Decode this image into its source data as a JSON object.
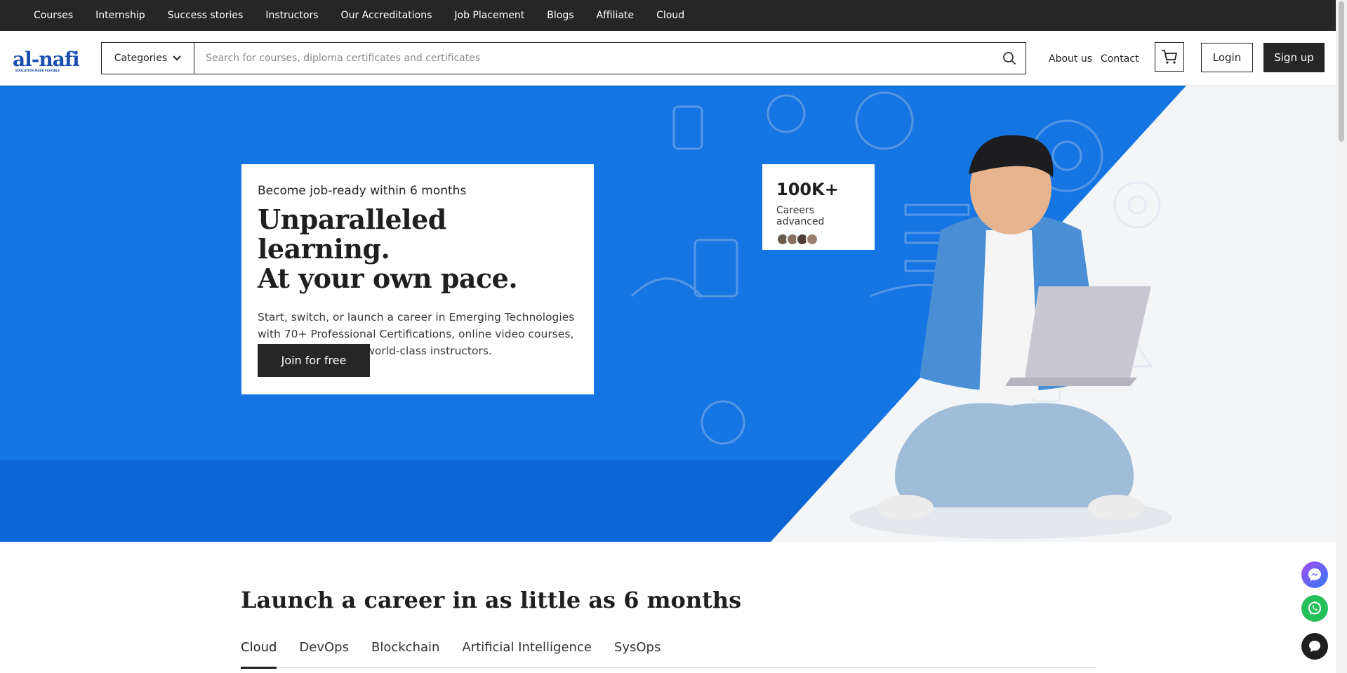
{
  "topnav": {
    "items": [
      "Courses",
      "Internship",
      "Success stories",
      "Instructors",
      "Our Accreditations",
      "Job Placement",
      "Blogs",
      "Affiliate",
      "Cloud"
    ]
  },
  "header": {
    "logo_text": "al-nafi",
    "logo_tagline": "EDUCATION MADE FLEXIBLE",
    "categories_label": "Categories",
    "search_placeholder": "Search for courses, diploma certificates and certificates",
    "about_label": "About us",
    "contact_label": "Contact",
    "login_label": "Login",
    "signup_label": "Sign up"
  },
  "hero": {
    "eyebrow": "Become job-ready within 6 months",
    "headline_line1": "Unparalleled learning.",
    "headline_line2": "At your own pace.",
    "description": "Start, switch, or launch a career in Emerging Technologies with 70+ Professional Certifications, online video courses, and programs from world-class instructors.",
    "cta_label": "Join for free",
    "stat_value": "100K+",
    "stat_label": "Careers advanced",
    "colors": {
      "primary_blue": "#1575e3",
      "dark": "#262626"
    }
  },
  "section": {
    "title": "Launch a career in as little as 6 months",
    "tabs": [
      "Cloud",
      "DevOps",
      "Blockchain",
      "Artificial Intelligence",
      "SysOps"
    ],
    "active_tab": "Cloud"
  }
}
